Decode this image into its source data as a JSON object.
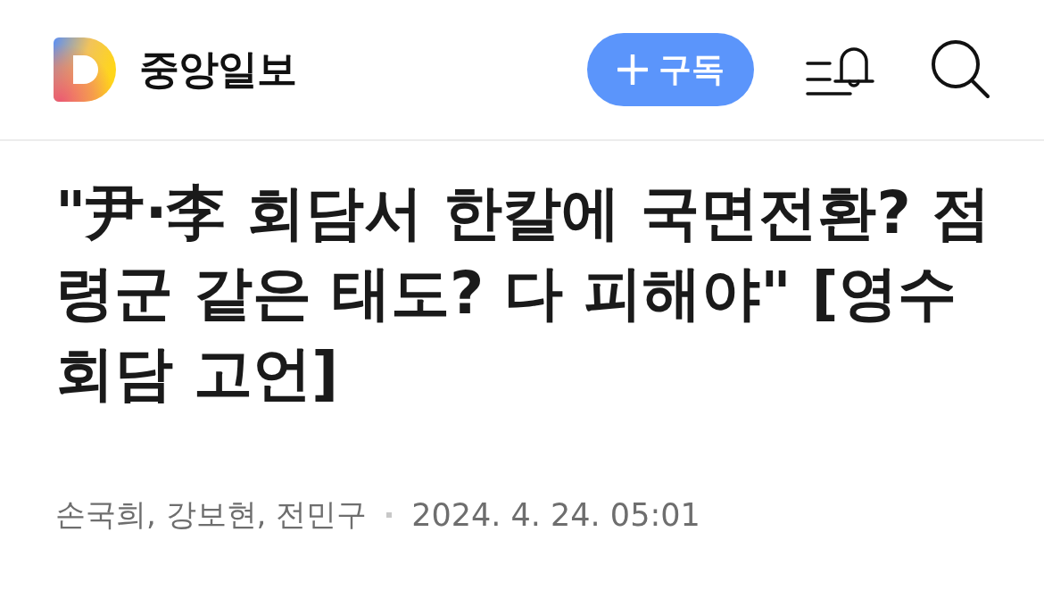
{
  "header": {
    "brand": "중앙일보",
    "subscribe_button": {
      "label": "구독"
    }
  },
  "article": {
    "headline": "\"尹·李 회담서 한칼에 국면전환? 점령군 같은 태도? 다 피해야\" [영수회담 고언]",
    "authors": "손국희, 강보현, 전민구",
    "date": "2024. 4. 24. 05:01"
  }
}
